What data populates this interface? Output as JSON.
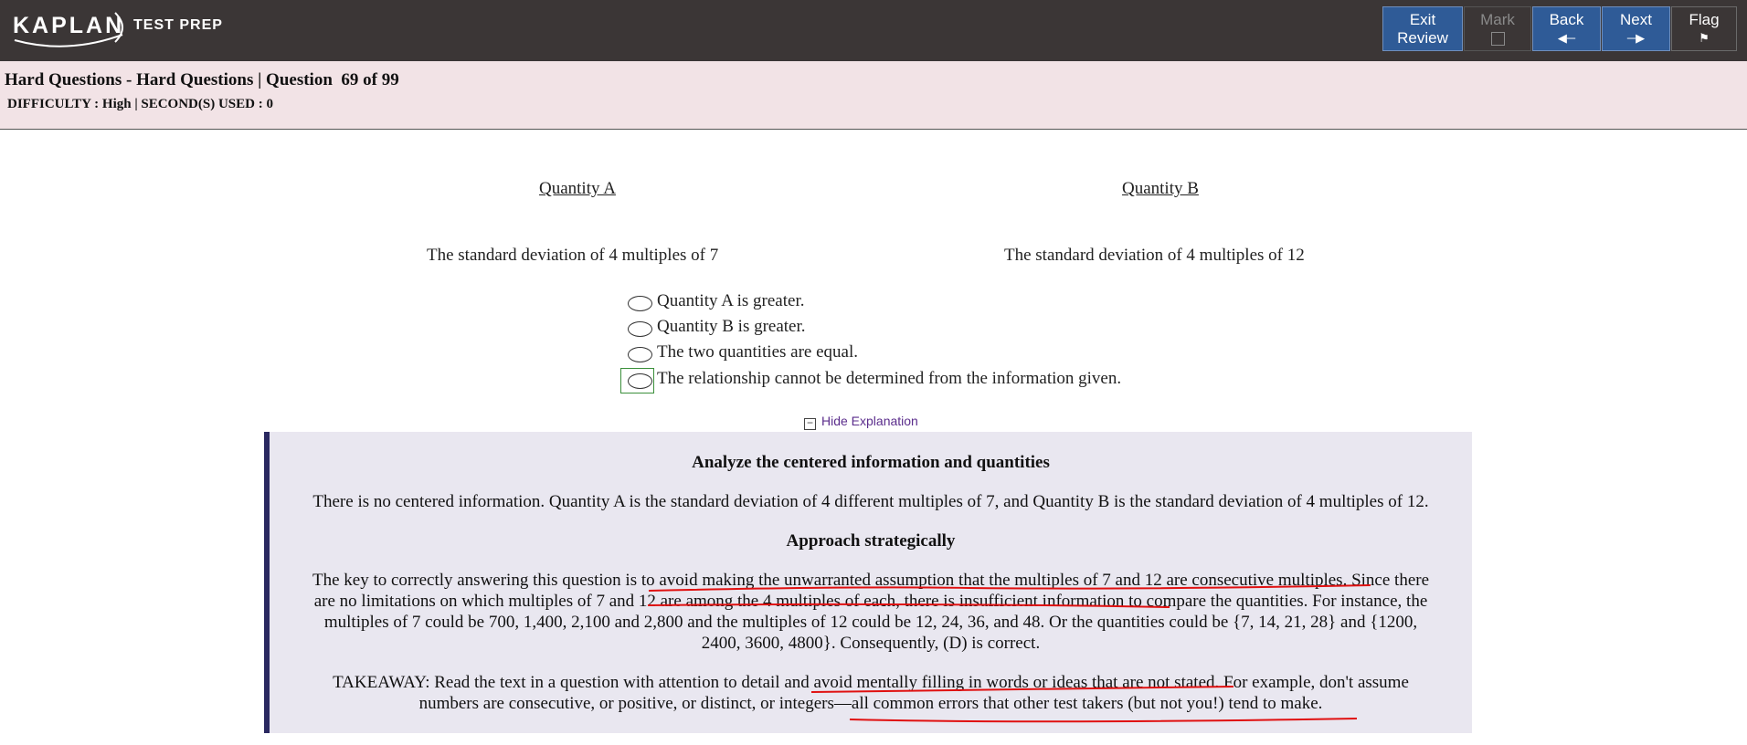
{
  "brand": {
    "name": "KAPLAN",
    "suffix": "TEST PREP"
  },
  "toolbar": {
    "exit_review": [
      "Exit",
      "Review"
    ],
    "mark": "Mark",
    "back": "Back",
    "next": "Next",
    "flag": "Flag",
    "colors": {
      "button_bg": "#2f5b97",
      "bar_bg": "#3b3636"
    }
  },
  "header": {
    "title": "Hard Questions - Hard Questions | Question  69 of 99",
    "sub": "DIFFICULTY : High | SECOND(S) USED : 0"
  },
  "question": {
    "quantity_a_label": "Quantity A",
    "quantity_b_label": "Quantity B",
    "quantity_a_text": "The standard deviation of 4 multiples of 7",
    "quantity_b_text": "The standard deviation of 4 multiples of 12",
    "choices": [
      "Quantity A is greater.",
      "Quantity B is greater.",
      "The two quantities are equal.",
      "The relationship cannot be determined from the information given."
    ]
  },
  "explanation": {
    "toggle_label": "Hide Explanation",
    "heading1": "Analyze the centered information and quantities",
    "para1": "There is no centered information. Quantity A is the standard deviation of 4 different multiples of 7, and Quantity B is the standard deviation of 4 multiples of 12.",
    "heading2": "Approach strategically",
    "para2_lines": [
      "The key to correctly answering this question is to avoid making the unwarranted assumption that the multiples of 7 and 12 are consecutive multiples. Since there",
      "are no limitations on which multiples of 7 and 12 are among the 4 multiples of each, there is insufficient information to compare the quantities. For instance, the",
      "multiples of 7 could be 700, 1,400, 2,100 and 2,800 and the multiples of 12 could be 12, 24, 36, and 48. Or the quantities could be {7, 14, 21, 28} and {1200,",
      "2400, 3600, 4800}. Consequently, (D) is correct."
    ],
    "takeaway_lines": [
      "TAKEAWAY: Read the text in a question with attention to detail and avoid mentally filling in words or ideas that are not stated. For example, don't assume",
      "numbers are consecutive, or positive, or distinct, or integers—all common errors that other test takers (but not you!) tend to make."
    ]
  }
}
